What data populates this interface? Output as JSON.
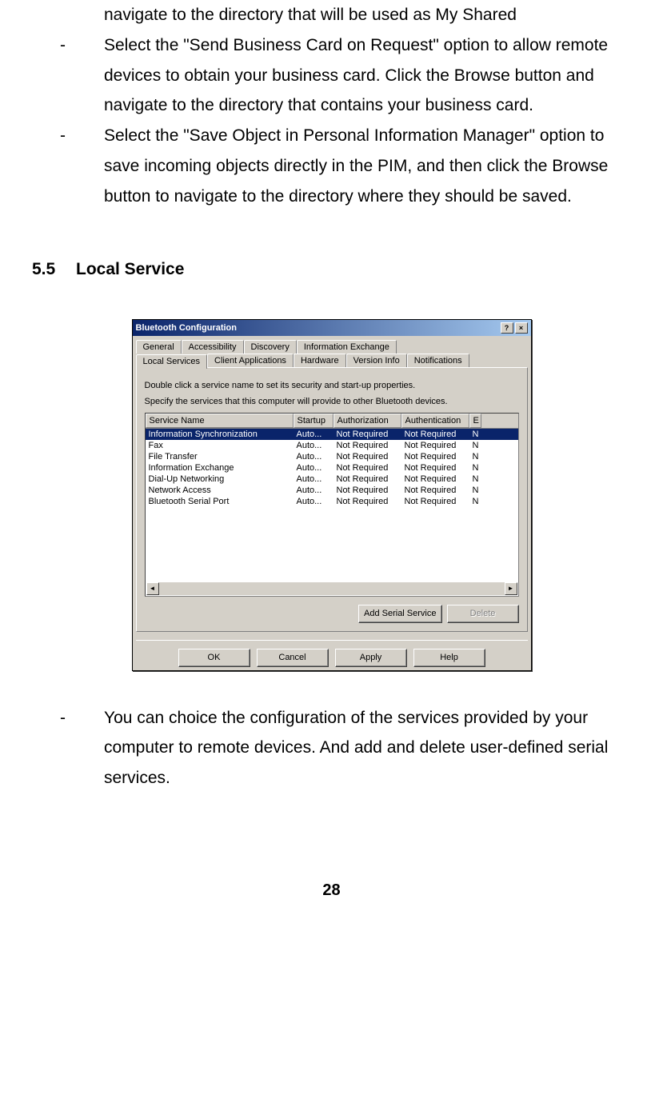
{
  "body": {
    "continued_line": "navigate to the directory that will be used as My Shared",
    "bullets": [
      {
        "dash": "-",
        "text": "Select the \"Send Business Card on Request\" option to allow remote devices to obtain your business card. Click the Browse button and navigate to the directory that contains your business card."
      },
      {
        "dash": "-",
        "text": "Select the \"Save Object in Personal Information Manager\" option to save incoming objects directly in the PIM, and then click the Browse button to navigate to the directory where they should be saved."
      }
    ],
    "after_bullet": {
      "dash": "-",
      "text": "You can choice the configuration of the services provided by your computer to remote devices. And add and delete user-defined serial services."
    }
  },
  "section": {
    "number": "5.5",
    "title": "Local Service"
  },
  "dialog": {
    "title": "Bluetooth Configuration",
    "help_btn": "?",
    "close_btn": "×",
    "tabs_row1": [
      "General",
      "Accessibility",
      "Discovery",
      "Information Exchange"
    ],
    "tabs_row2": [
      "Local Services",
      "Client Applications",
      "Hardware",
      "Version Info",
      "Notifications"
    ],
    "active_tab": "Local Services",
    "panel_text1": "Double click a service name to set its security and start-up properties.",
    "panel_text2": "Specify the services that this computer will provide to other Bluetooth devices.",
    "columns": [
      "Service Name",
      "Startup",
      "Authorization",
      "Authentication",
      "E"
    ],
    "rows": [
      {
        "name": "Information Synchronization",
        "startup": "Auto...",
        "auth": "Not Required",
        "authn": "Not Required",
        "e": "N",
        "selected": true
      },
      {
        "name": "Fax",
        "startup": "Auto...",
        "auth": "Not Required",
        "authn": "Not Required",
        "e": "N",
        "selected": false
      },
      {
        "name": "File Transfer",
        "startup": "Auto...",
        "auth": "Not Required",
        "authn": "Not Required",
        "e": "N",
        "selected": false
      },
      {
        "name": "Information Exchange",
        "startup": "Auto...",
        "auth": "Not Required",
        "authn": "Not Required",
        "e": "N",
        "selected": false
      },
      {
        "name": "Dial-Up Networking",
        "startup": "Auto...",
        "auth": "Not Required",
        "authn": "Not Required",
        "e": "N",
        "selected": false
      },
      {
        "name": "Network Access",
        "startup": "Auto...",
        "auth": "Not Required",
        "authn": "Not Required",
        "e": "N",
        "selected": false
      },
      {
        "name": "Bluetooth Serial Port",
        "startup": "Auto...",
        "auth": "Not Required",
        "authn": "Not Required",
        "e": "N",
        "selected": false
      }
    ],
    "add_serial": "Add Serial Service",
    "delete": "Delete",
    "ok": "OK",
    "cancel": "Cancel",
    "apply": "Apply",
    "help": "Help"
  },
  "page_number": "28"
}
